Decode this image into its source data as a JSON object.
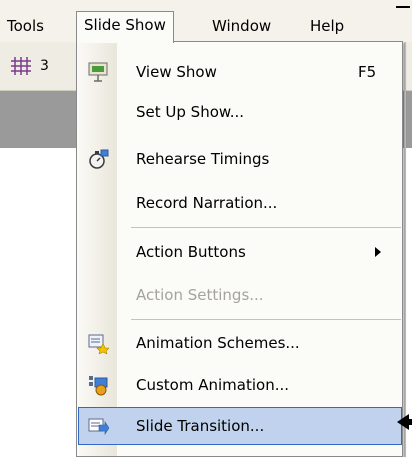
{
  "menubar": {
    "items": [
      {
        "label": "Tools"
      },
      {
        "label": "Slide Show"
      },
      {
        "label": "Window"
      },
      {
        "label": "Help"
      }
    ]
  },
  "toolbar": {
    "zoom_text": "3"
  },
  "menu": {
    "items": [
      {
        "label": "View Show",
        "shortcut": "F5",
        "icon": "view-show-icon"
      },
      {
        "label": "Set Up Show..."
      },
      {
        "label": "Rehearse Timings",
        "icon": "stopwatch-icon"
      },
      {
        "label": "Record Narration..."
      },
      {
        "label": "Action Buttons",
        "submenu": true
      },
      {
        "label": "Action Settings...",
        "disabled": true
      },
      {
        "label": "Animation Schemes...",
        "icon": "animation-schemes-icon"
      },
      {
        "label": "Custom Animation...",
        "icon": "custom-animation-icon"
      },
      {
        "label": "Slide Transition...",
        "icon": "slide-transition-icon",
        "highlighted": true
      }
    ]
  },
  "colors": {
    "highlight_bg": "#c1d2ee",
    "highlight_border": "#316ac5",
    "menubar_bg": "#f4f2ea"
  }
}
